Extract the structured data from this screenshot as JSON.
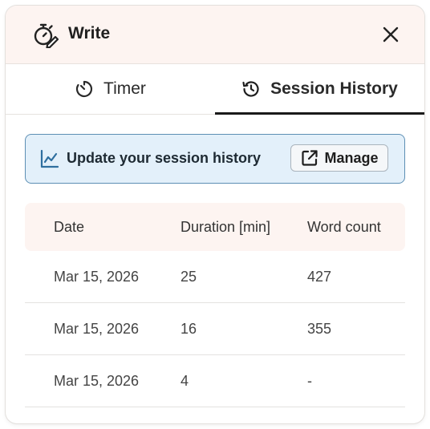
{
  "header": {
    "title": "Write",
    "icon": "stopwatch-pencil-icon",
    "close_icon": "close-icon"
  },
  "tabs": [
    {
      "label": "Timer",
      "icon": "timer-icon",
      "active": false
    },
    {
      "label": "Session History",
      "icon": "history-icon",
      "active": true
    }
  ],
  "notice": {
    "text": "Update your session history",
    "icon": "chart-line-icon",
    "button_label": "Manage",
    "button_icon": "external-link-icon"
  },
  "table": {
    "headers": [
      "Date",
      "Duration [min]",
      "Word count"
    ],
    "rows": [
      [
        "Mar 15, 2026",
        "25",
        "427"
      ],
      [
        "Mar 15, 2026",
        "16",
        "355"
      ],
      [
        "Mar 15, 2026",
        "4",
        "-"
      ]
    ]
  },
  "colors": {
    "header_bg": "#fdf4f1",
    "notice_bg": "#e3f0fa",
    "notice_border": "#5d8fb4",
    "active_tab_underline": "#1a1a1a"
  }
}
